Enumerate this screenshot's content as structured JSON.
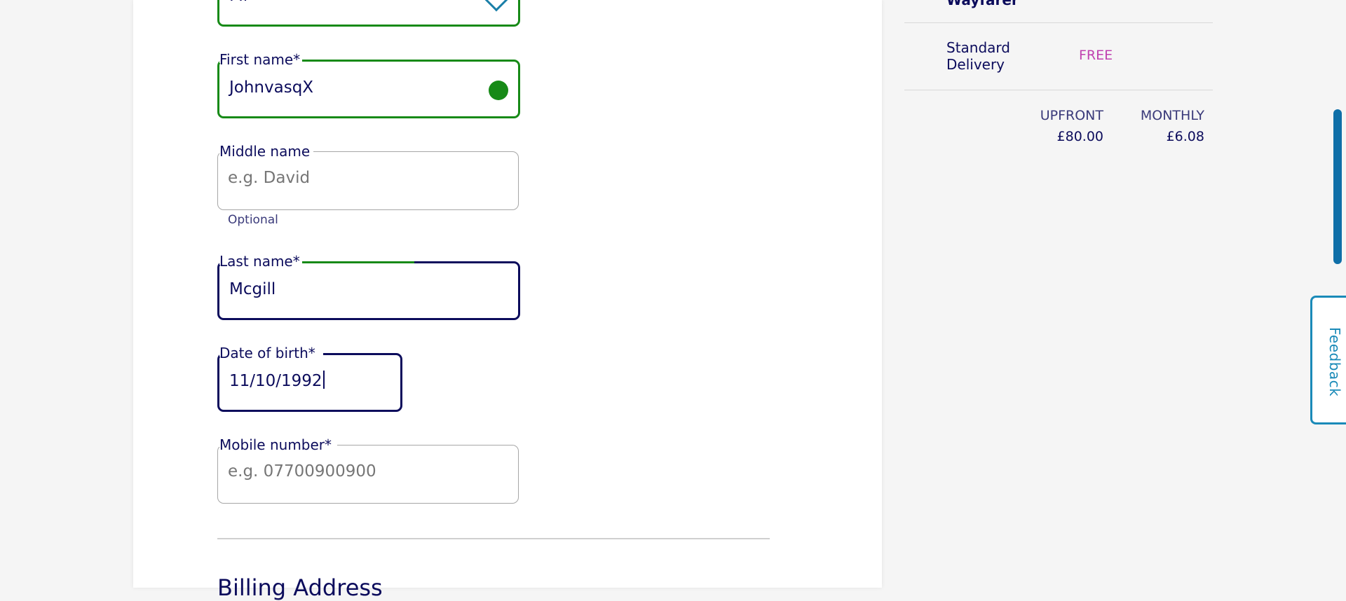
{
  "form": {
    "title_field": {
      "value": "Mr"
    },
    "first_name": {
      "label": "First name*",
      "value": "JohnvasqX"
    },
    "middle_name": {
      "label": "Middle name",
      "placeholder": "e.g. David",
      "hint": "Optional"
    },
    "last_name": {
      "label": "Last name*",
      "value": "Mcgill"
    },
    "date_of_birth": {
      "label": "Date of birth*",
      "value": "11/10/1992"
    },
    "mobile_number": {
      "label": "Mobile number*",
      "placeholder": "e.g. 07700900900"
    },
    "billing_heading": "Billing Address"
  },
  "summary": {
    "cut_item": "Wayfarer",
    "delivery": {
      "name": "Standard Delivery",
      "price": "FREE"
    },
    "totals": {
      "upfront_label": "UPFRONT",
      "upfront_value": "£80.00",
      "monthly_label": "MONTHLY",
      "monthly_value": "£6.08"
    }
  },
  "feedback_label": "Feedback",
  "colors": {
    "valid": "#178a17",
    "focus": "#0c0c5c",
    "accent": "#1a8ab8",
    "free": "#c041b0"
  }
}
